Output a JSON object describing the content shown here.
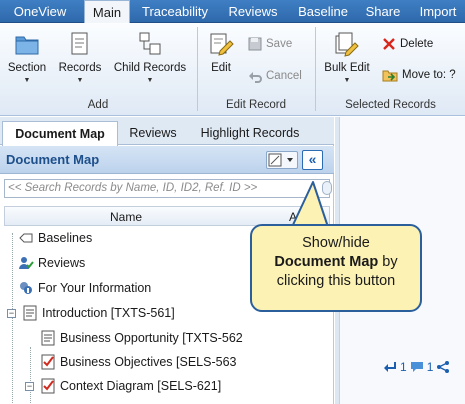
{
  "ribbon": {
    "tabs": [
      "OneView",
      "Main",
      "Traceability",
      "Reviews",
      "Baseline",
      "Share",
      "Import"
    ],
    "active_tab": "Main",
    "groups": {
      "add": {
        "label": "Add",
        "section": "Section",
        "records": "Records",
        "child_records": "Child Records"
      },
      "edit_record": {
        "label": "Edit Record",
        "edit": "Edit",
        "save": "Save",
        "cancel": "Cancel"
      },
      "selected_records": {
        "label": "Selected Records",
        "bulk_edit": "Bulk Edit",
        "delete": "Delete",
        "move_to": "Move to: ?"
      }
    }
  },
  "panel": {
    "tabs": [
      "Document Map",
      "Reviews",
      "Highlight Records"
    ],
    "active_tab": "Document Map",
    "title": "Document Map",
    "collapse_glyph": "«",
    "search_placeholder": "<< Search Records by Name, ID, ID2, Ref. ID >>",
    "columns": {
      "name": "Name",
      "app": "App"
    },
    "tree": [
      {
        "label": "Baselines",
        "icon": "baseline-icon"
      },
      {
        "label": "Reviews",
        "icon": "reviews-icon"
      },
      {
        "label": "For Your Information",
        "icon": "fyi-icon"
      },
      {
        "label": "Introduction [TXTS-561]",
        "icon": "document-icon",
        "toggle": "−"
      },
      {
        "label": "Business Opportunity [TXTS-562",
        "icon": "document-icon"
      },
      {
        "label": "Business Objectives [SELS-563",
        "icon": "requirement-icon"
      },
      {
        "label": "Context Diagram [SELS-621]",
        "icon": "requirement-icon",
        "toggle": "−"
      }
    ]
  },
  "metrics": {
    "links": "1",
    "comments": "1"
  },
  "callout": {
    "line1": "Show/hide",
    "line2_bold": "Document Map",
    "line2_rest": " by",
    "line3": "clicking this button"
  },
  "colors": {
    "ribbon_tab_bar": "#3f7fc4",
    "callout_fill": "#fcf2b4",
    "callout_border": "#2b5f9c",
    "accent": "#1c5fb0"
  }
}
